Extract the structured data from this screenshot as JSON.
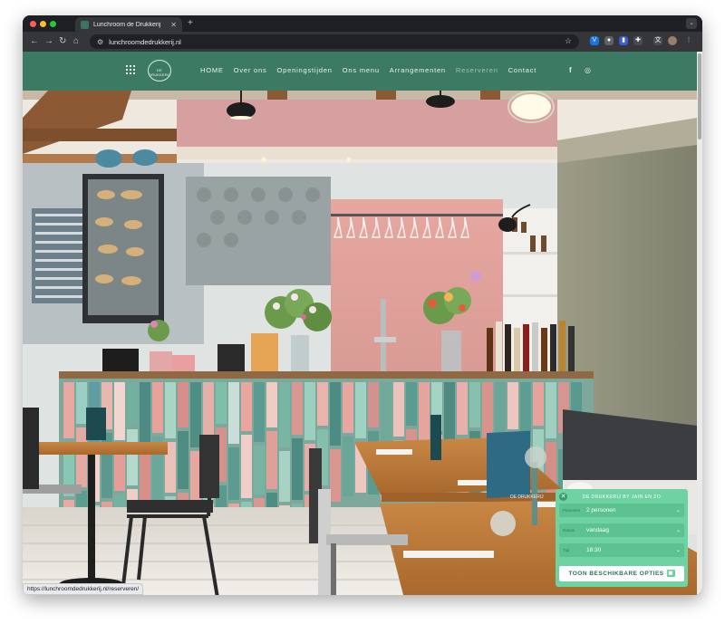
{
  "browser": {
    "tab_title": "Lunchroom de Drukkerij",
    "url": "lunchroomdedrukkerij.nl",
    "status_url": "https://lunchroomdedrukkerij.nl/reserveren/"
  },
  "site": {
    "logo_text": "DE DRUKKERIJ",
    "nav": [
      {
        "label": "HOME"
      },
      {
        "label": "Over ons"
      },
      {
        "label": "Openingstijden"
      },
      {
        "label": "Ons menu"
      },
      {
        "label": "Arrangementen"
      },
      {
        "label": "Reserveren"
      },
      {
        "label": "Contact"
      }
    ],
    "active_nav": "Reserveren",
    "social": [
      "facebook-icon",
      "instagram-icon"
    ]
  },
  "scene": {
    "sign_text": "DE DRUKKERIJ"
  },
  "widget": {
    "header": "DE DRUKKERIJ BY JAIN EN ZO",
    "rows": [
      {
        "label": "Personen",
        "value": "2 personen"
      },
      {
        "label": "Datum",
        "value": "vandaag"
      },
      {
        "label": "Tijd",
        "value": "18:30"
      }
    ],
    "button_label": "TOON BESCHIKBARE OPTIES"
  },
  "colors": {
    "brand_green": "#3c7a64",
    "widget_green": "#6fd2a3"
  }
}
